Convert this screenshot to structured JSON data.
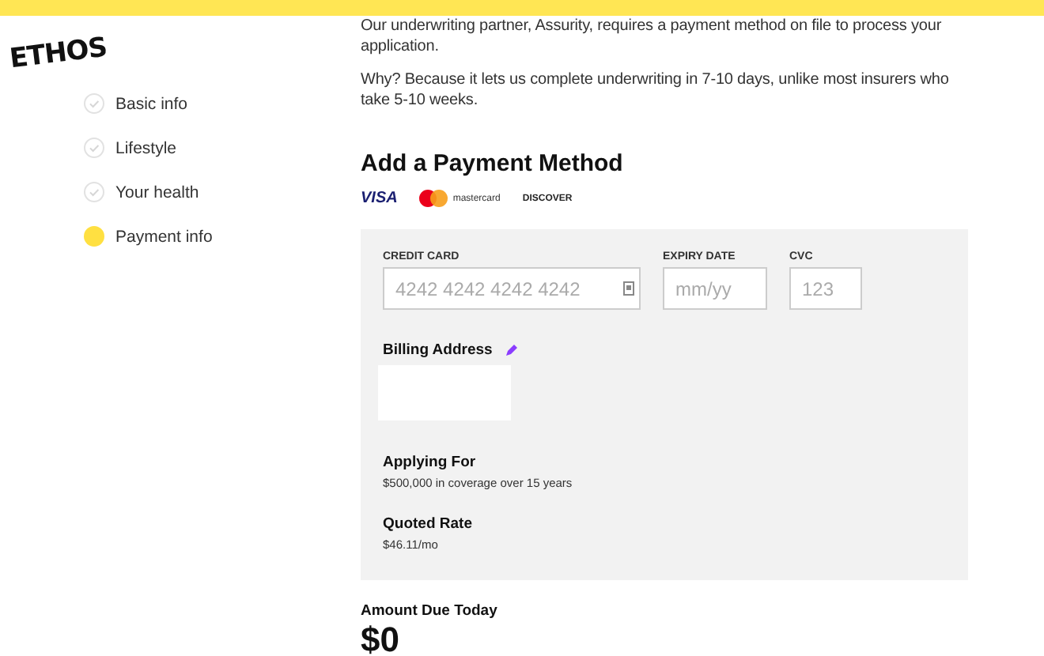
{
  "logo": "ETHOS",
  "steps": [
    {
      "label": "Basic info",
      "selected": false
    },
    {
      "label": "Lifestyle",
      "selected": false
    },
    {
      "label": "Your health",
      "selected": false
    },
    {
      "label": "Payment info",
      "selected": true
    }
  ],
  "intro": [
    "Our underwriting partner, Assurity, requires a payment method on file to process your application.",
    "Why? Because it lets us complete underwriting in 7-10 days, unlike most insurers who take 5-10 weeks."
  ],
  "heading": "Add a Payment Method",
  "card_brands": [
    "VISA",
    "mastercard",
    "DISCOVER"
  ],
  "fields": [
    {
      "label": "CREDIT CARD",
      "placeholder": "4242 4242 4242 4242",
      "kind": "card"
    },
    {
      "label": "EXPIRY DATE",
      "placeholder": "mm/yy",
      "kind": "plain"
    },
    {
      "label": "CVC",
      "placeholder": "123",
      "kind": "plain"
    }
  ],
  "billing": {
    "title": "Billing Address"
  },
  "summary": [
    {
      "title": "Applying For",
      "value": "$500,000 in coverage over 15 years"
    },
    {
      "title": "Quoted Rate",
      "value": "$46.11/mo"
    }
  ],
  "amount_due": {
    "title": "Amount Due Today",
    "value": "$0"
  }
}
